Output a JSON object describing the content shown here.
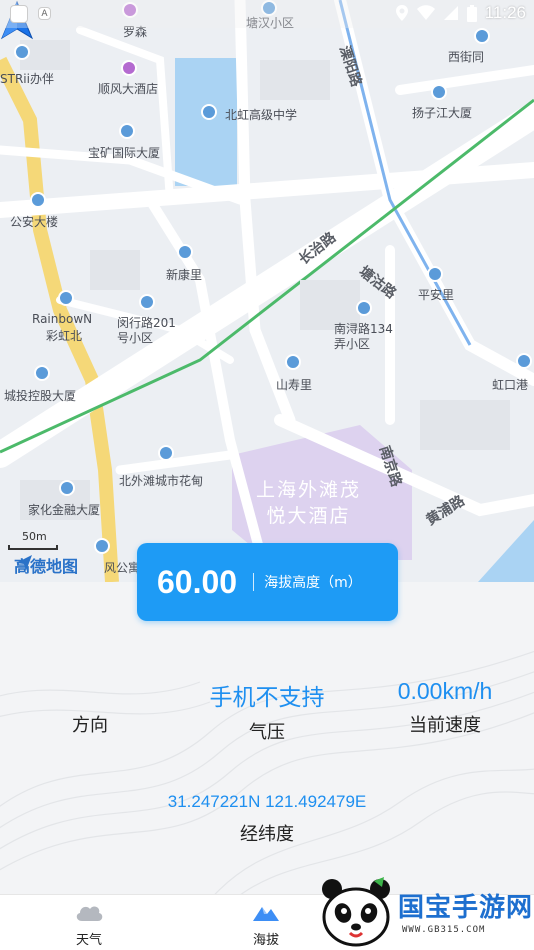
{
  "status_bar": {
    "time": "11:26",
    "box_label": "A"
  },
  "map": {
    "labels": {
      "luosen": "罗森",
      "tanghan": "塘汉小区",
      "liyang_road": "溧阳路",
      "xijie": "西街同",
      "stri": "STRii办伴",
      "shunfeng": "顺风大酒店",
      "beihong": "北虹高级中学",
      "yangzijiang": "扬子江大厦",
      "baoguang": "宝矿国际大厦",
      "changzhi_road": "长治路",
      "gongan": "公安大楼",
      "xinkang": "新康里",
      "tanggu_road": "塘沽路",
      "pingan": "平安里",
      "rainbow": "RainbowN",
      "caihong": "彩虹北",
      "minhang": "闵行路201\n号小区",
      "nanxun": "南浔路134\n弄小区",
      "chengtou": "城投控股大厦",
      "shanshou": "山寿里",
      "hongkougang": "虹口港",
      "nanjing_road": "南京路",
      "beiwaitan": "北外滩城市花甸",
      "hotel": "上海外滩茂\n悦大酒店",
      "huangpu_road": "黄浦路",
      "jiahua": "家化金融大厦",
      "fenggong": "风公寓"
    },
    "scale": "50m",
    "logo": "高德地图"
  },
  "altitude": {
    "value": "60.00",
    "label": "海拔高度（m）"
  },
  "metrics": {
    "direction": {
      "value": "",
      "label": "方向"
    },
    "pressure": {
      "value": "手机不支持",
      "label": "气压"
    },
    "speed": {
      "value": "0.00km/h",
      "label": "当前速度"
    },
    "coordinates": {
      "value": "31.247221N 121.492479E",
      "label": "经纬度"
    }
  },
  "tabs": [
    {
      "label": "天气",
      "icon": "cloud-icon"
    },
    {
      "label": "海拔",
      "icon": "mountain-icon"
    }
  ],
  "watermark": {
    "text": "国宝手游网",
    "url": "WWW.GB315.COM"
  },
  "colors": {
    "accent": "#1e9bf5",
    "value_text": "#1e8ff0",
    "map_bg": "#eceff3",
    "route": "#4cba6a"
  }
}
